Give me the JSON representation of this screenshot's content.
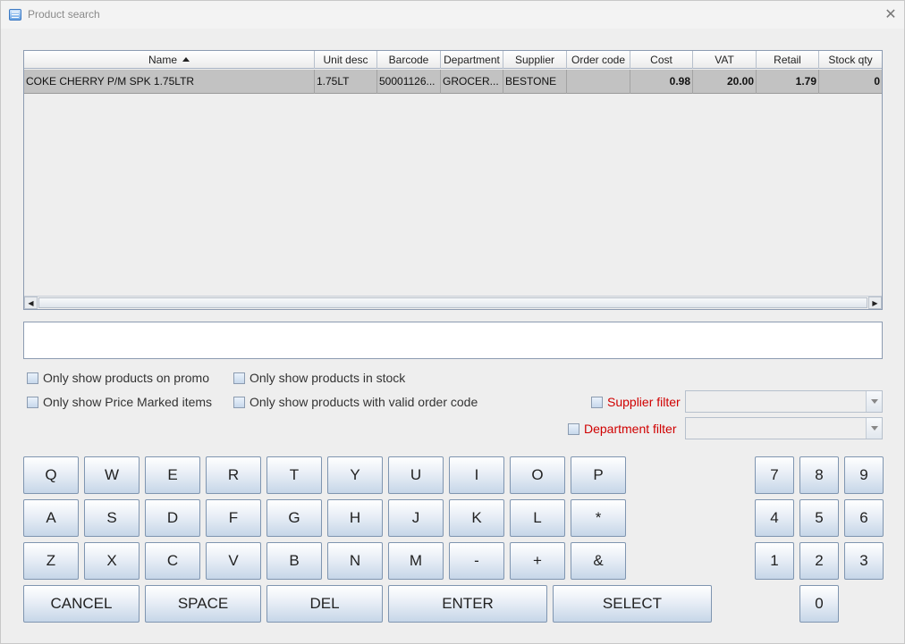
{
  "window": {
    "title": "Product search",
    "close_glyph": "✕"
  },
  "table": {
    "columns": [
      "Name",
      "Unit desc",
      "Barcode",
      "Department",
      "Supplier",
      "Order code",
      "Cost",
      "VAT",
      "Retail",
      "Stock qty"
    ],
    "rows": [
      {
        "name": "COKE CHERRY P/M SPK 1.75LTR",
        "unit_desc": "1.75LT",
        "barcode": "50001126...",
        "department": "GROCER...",
        "supplier": "BESTONE",
        "order_code": "",
        "cost": "0.98",
        "vat": "20.00",
        "retail": "1.79",
        "stock_qty": "0"
      }
    ],
    "scroll_left": "◀",
    "scroll_right": "▶"
  },
  "search": {
    "value": ""
  },
  "filters": {
    "promo": "Only show products on promo",
    "in_stock": "Only show products in stock",
    "price_marked": "Only show Price Marked items",
    "valid_order_code": "Only show products with valid order code",
    "supplier_filter": "Supplier filter",
    "department_filter": "Department filter"
  },
  "keyboard": {
    "row1": [
      "Q",
      "W",
      "E",
      "R",
      "T",
      "Y",
      "U",
      "I",
      "O",
      "P"
    ],
    "row2": [
      "A",
      "S",
      "D",
      "F",
      "G",
      "H",
      "J",
      "K",
      "L",
      "*"
    ],
    "row3": [
      "Z",
      "X",
      "C",
      "V",
      "B",
      "N",
      "M",
      "-",
      "+",
      "&"
    ],
    "actions": [
      "CANCEL",
      "SPACE",
      "DEL",
      "ENTER",
      "SELECT"
    ],
    "numpad": [
      "7",
      "8",
      "9",
      "4",
      "5",
      "6",
      "1",
      "2",
      "3",
      "0"
    ]
  }
}
